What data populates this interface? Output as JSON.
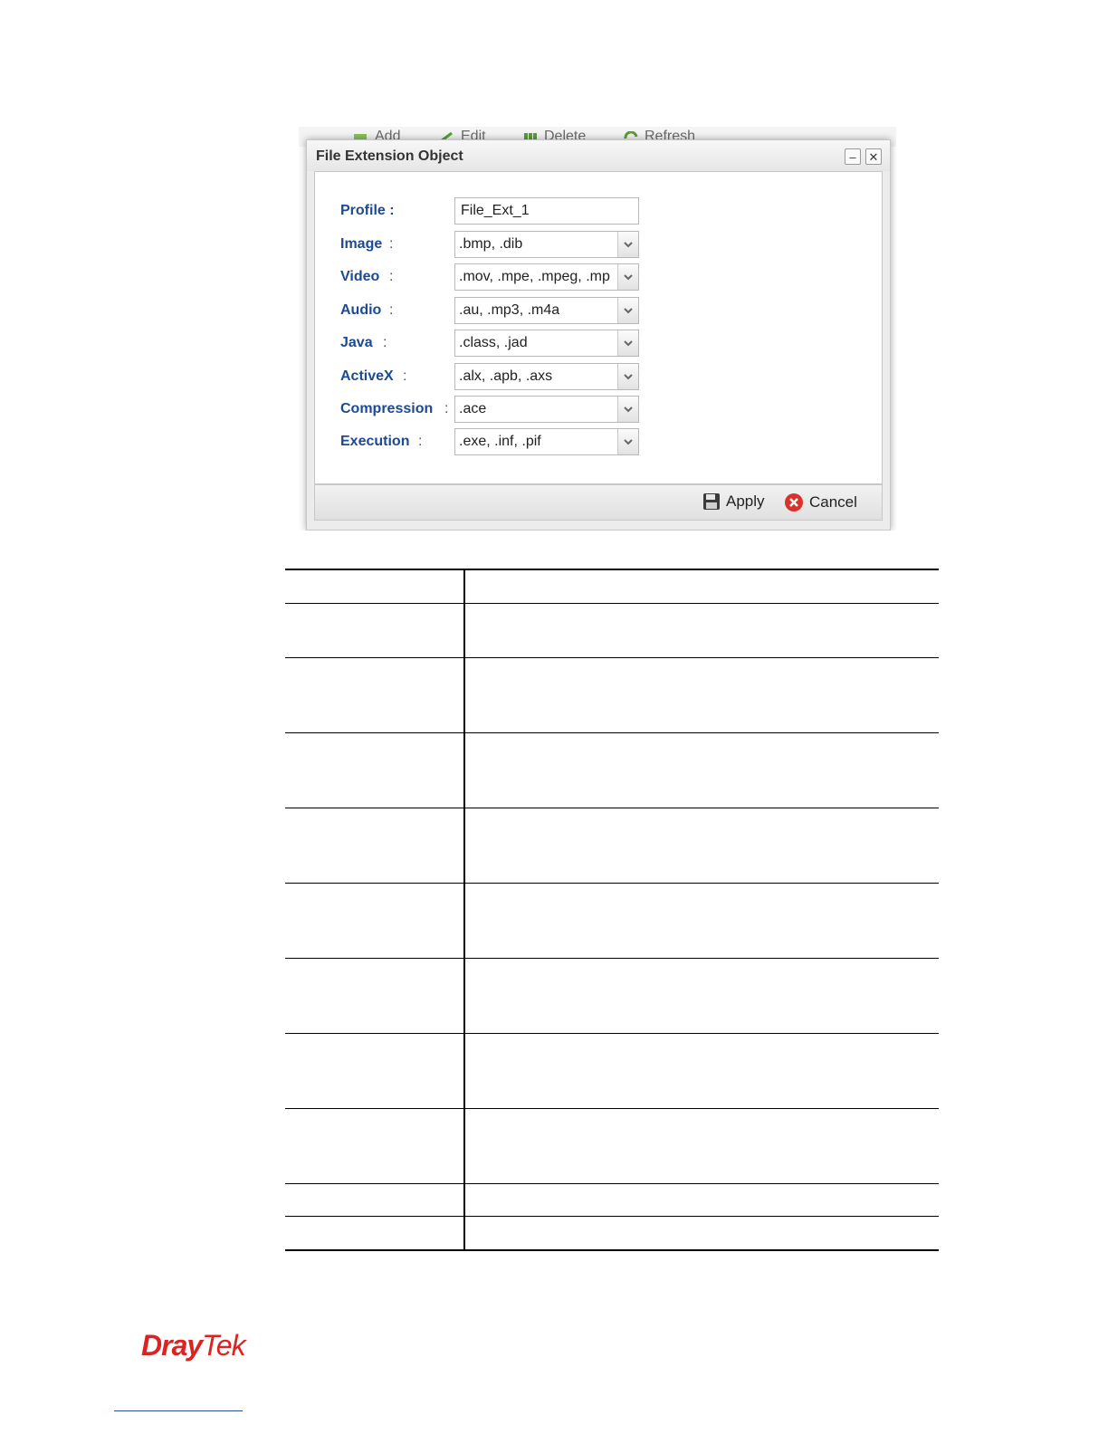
{
  "toolbar": {
    "add": "Add",
    "edit": "Edit",
    "delete": "Delete",
    "refresh": "Refresh"
  },
  "dialog": {
    "title": "File Extension Object",
    "minimize": "–",
    "close": "✕",
    "profile": {
      "label": "Profile :",
      "value": "File_Ext_1"
    },
    "fields": [
      {
        "label": "Image",
        "value": ".bmp, .dib"
      },
      {
        "label": "Video",
        "value": ".mov, .mpe, .mpeg, .mp"
      },
      {
        "label": "Audio",
        "value": ".au, .mp3, .m4a"
      },
      {
        "label": "Java",
        "value": ".class, .jad"
      },
      {
        "label": "ActiveX",
        "value": ".alx, .apb, .axs"
      },
      {
        "label": "Compression",
        "value": ".ace"
      },
      {
        "label": "Execution",
        "value": ".exe, .inf, .pif"
      }
    ],
    "colon": ":",
    "apply": "Apply",
    "cancel": "Cancel"
  },
  "brand": {
    "logo_part1": "Dray",
    "logo_part2": "Tek",
    "color": "#d22222"
  }
}
